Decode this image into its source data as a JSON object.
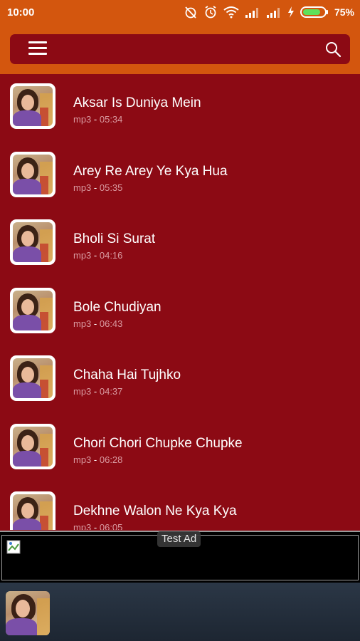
{
  "status_bar": {
    "time": "10:00",
    "battery_percent": "75%",
    "icons": [
      "alarm-off-icon",
      "alarm-clock-icon",
      "wifi-icon",
      "signal-icon",
      "signal-icon",
      "charging-icon",
      "battery-icon"
    ]
  },
  "colors": {
    "status_bar": "#d3560e",
    "app_background": "#8c0a14",
    "player_background": "#1d2632"
  },
  "search_bar": {
    "menu_icon": "hamburger-menu-icon",
    "search_icon": "search-icon"
  },
  "songs": [
    {
      "title": "Aksar Is Duniya Mein",
      "format": "mp3",
      "duration": "05:34"
    },
    {
      "title": "Arey Re Arey Ye Kya Hua",
      "format": "mp3",
      "duration": "05:35"
    },
    {
      "title": "Bholi Si Surat",
      "format": "mp3",
      "duration": "04:16"
    },
    {
      "title": "Bole Chudiyan",
      "format": "mp3",
      "duration": "06:43"
    },
    {
      "title": "Chaha Hai Tujhko",
      "format": "mp3",
      "duration": "04:37"
    },
    {
      "title": "Chori Chori Chupke Chupke",
      "format": "mp3",
      "duration": "06:28"
    },
    {
      "title": "Dekhne Walon Ne Kya Kya",
      "format": "mp3",
      "duration": "06:05"
    }
  ],
  "sub_separator": " - ",
  "ad": {
    "label": "Test Ad"
  }
}
